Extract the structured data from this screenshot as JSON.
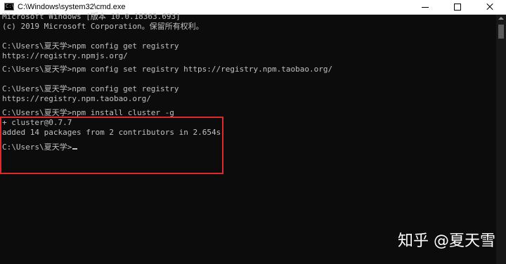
{
  "window": {
    "title": "C:\\Windows\\system32\\cmd.exe",
    "icon": "cmd-icon",
    "icon_glyph": "C:\\"
  },
  "console": {
    "lines": {
      "l1": "Microsoft Windows [版本 10.0.18363.693]",
      "l2": "(c) 2019 Microsoft Corporation。保留所有权利。",
      "l4": "C:\\Users\\夏天学>npm config get registry",
      "l5": "https://registry.npmjs.org/",
      "l7": "C:\\Users\\夏天学>npm config set registry https://registry.npm.taobao.org/",
      "l9": "C:\\Users\\夏天学>npm config get registry",
      "l10": "https://registry.npm.taobao.org/",
      "l12": "C:\\Users\\夏天学>npm install cluster -g",
      "l13": "+ cluster@0.7.7",
      "l14": "added 14 packages from 2 contributors in 2.654s",
      "l16": "C:\\Users\\夏天学>"
    },
    "text_color": "#c0c0c0",
    "background": "#0c0c0c",
    "highlight_color": "#e0292c"
  },
  "watermark": {
    "text": "知乎 @夏天雪"
  }
}
